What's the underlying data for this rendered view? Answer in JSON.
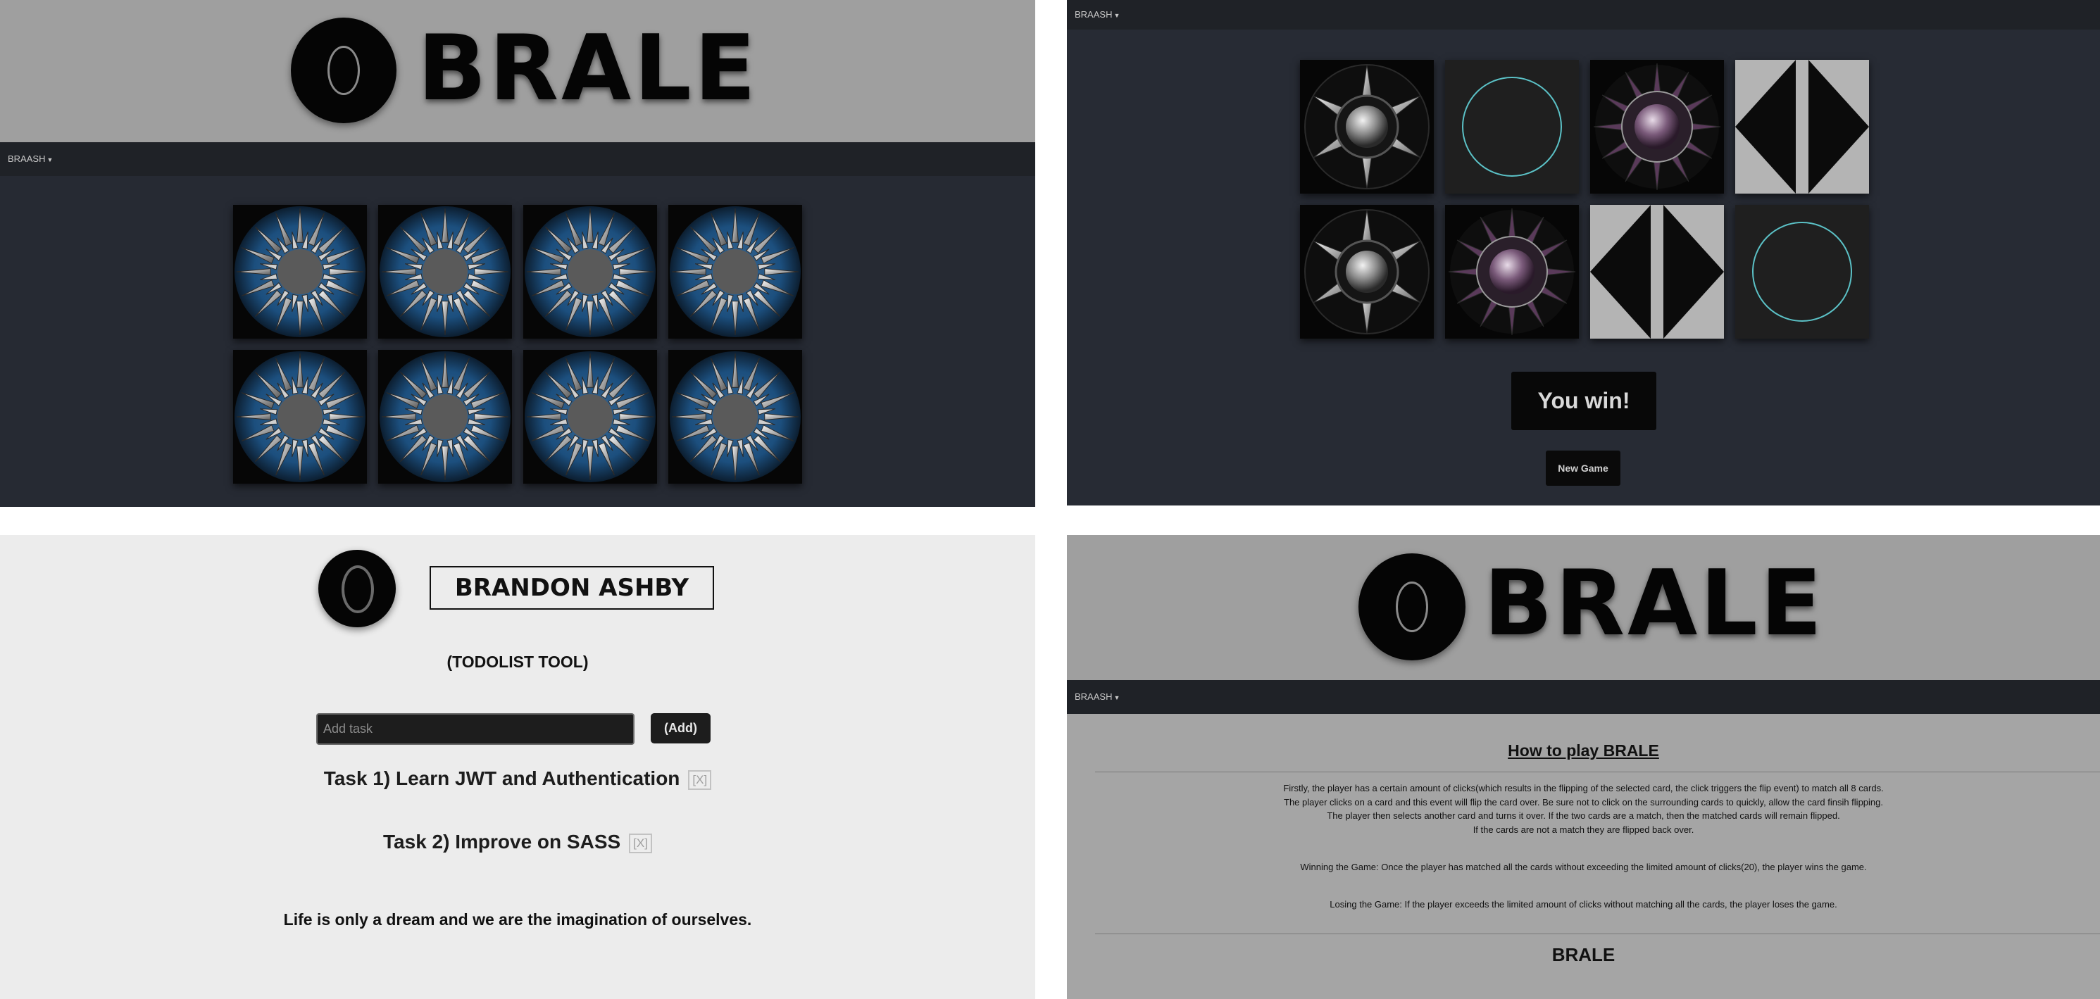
{
  "brand": {
    "name": "BRALE",
    "nav_label": "BRAASH"
  },
  "colors": {
    "page_bg": "#262a33",
    "navbar": "#1f2227",
    "header_band": "#9f9f9f",
    "card_back_blue": "#1c4f7e",
    "ring_teal": "#5bc1c6"
  },
  "game_panel": {
    "cards": [
      "card-back",
      "card-back",
      "card-back",
      "card-back",
      "card-back",
      "card-back",
      "card-back",
      "card-back"
    ]
  },
  "win_panel": {
    "cards": [
      "silver-star",
      "teal-circle",
      "purple-star",
      "diamond",
      "silver-star",
      "purple-star",
      "diamond",
      "teal-circle"
    ],
    "win_text": "You win!",
    "new_game_label": "New Game"
  },
  "todo_panel": {
    "name": "BRANDON ASHBY",
    "subtitle": "(TODOLIST TOOL)",
    "input_placeholder": "Add task",
    "add_label": "(Add)",
    "tasks": [
      {
        "text": "Task 1) Learn JWT and Authentication",
        "remove": "[X]"
      },
      {
        "text": "Task 2) Improve on SASS",
        "remove": "[X]"
      }
    ],
    "quote": "Life is only a dream and we are the imagination of ourselves."
  },
  "howto_panel": {
    "title": "How to play BRALE",
    "rules": [
      "Firstly, the player has a certain amount of clicks(which results in the flipping of the selected card, the click triggers the flip event) to match all 8 cards.",
      "The player clicks on a card and this event will flip the card over. Be sure not to click on the surrounding cards to quickly, allow the card finsih flipping.",
      "The player then selects another card and turns it over. If the two cards are a match, then the matched cards will remain flipped.",
      "If the cards are not a match they are flipped back over."
    ],
    "winning": "Winning the Game: Once the player has matched all the cards without exceeding the limited amount of clicks(20), the player wins the game.",
    "losing": "Losing the Game: If the player exceeds the limited amount of clicks without matching all the cards, the player loses the game.",
    "footer": "BRALE"
  }
}
